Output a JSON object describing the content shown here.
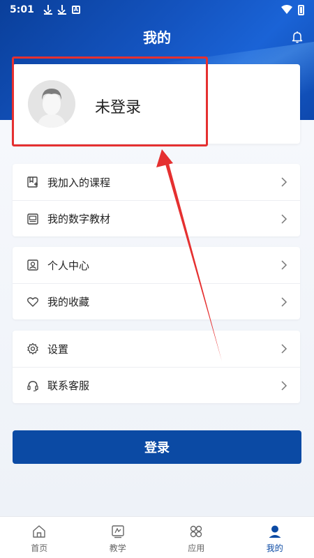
{
  "status_bar": {
    "time": "5:01"
  },
  "header": {
    "title": "我的"
  },
  "profile": {
    "name": "未登录"
  },
  "menu_groups": [
    {
      "items": [
        {
          "label": "我加入的课程",
          "icon": "course-icon"
        },
        {
          "label": "我的数字教材",
          "icon": "textbook-icon"
        }
      ]
    },
    {
      "items": [
        {
          "label": "个人中心",
          "icon": "user-card-icon"
        },
        {
          "label": "我的收藏",
          "icon": "heart-icon"
        }
      ]
    },
    {
      "items": [
        {
          "label": "设置",
          "icon": "gear-icon"
        },
        {
          "label": "联系客服",
          "icon": "headset-icon"
        }
      ]
    }
  ],
  "login_button": "登录",
  "tabs": [
    {
      "label": "首页",
      "icon": "home-icon"
    },
    {
      "label": "教学",
      "icon": "teaching-icon"
    },
    {
      "label": "应用",
      "icon": "apps-icon"
    },
    {
      "label": "我的",
      "icon": "me-icon",
      "active": true
    }
  ],
  "colors": {
    "primary": "#0b4aa4",
    "annotation": "#e53030"
  }
}
